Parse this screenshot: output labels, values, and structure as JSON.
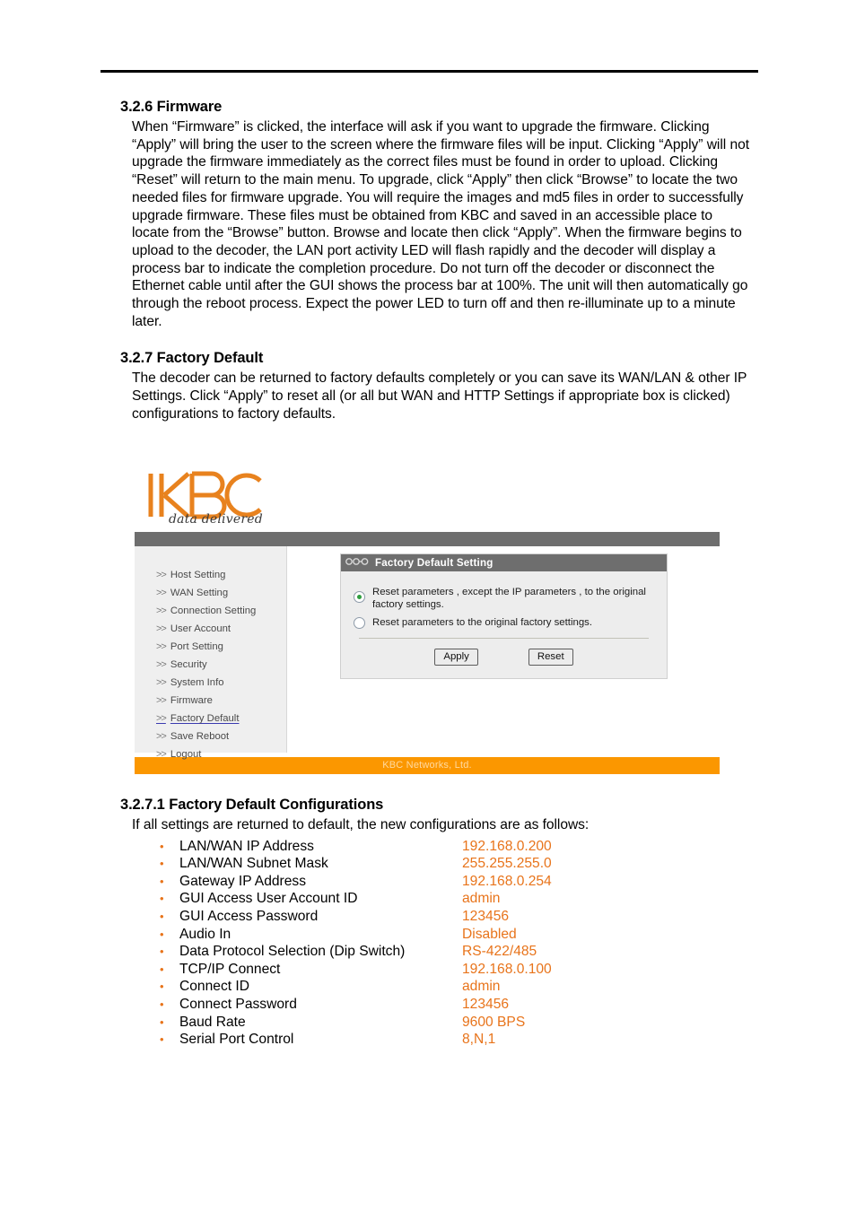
{
  "colors": {
    "accent_orange": "#e8741b",
    "ui_footer_orange": "#fb9700",
    "ui_gray_bar": "#6e6e6e",
    "ui_sidebar": "#efefef",
    "radio_selected_green": "#2f9e3f",
    "active_link_underline": "#3b3bb0"
  },
  "sections": [
    {
      "number_title": "3.2.6 Firmware",
      "body": "When “Firmware” is clicked, the interface will ask if you want to upgrade the firmware. Clicking “Apply” will bring the user to the screen where the firmware files will be input. Clicking “Apply” will not upgrade the firmware immediately as the correct files must be found in order to upload. Clicking “Reset” will return to the main menu. To upgrade, click “Apply” then click “Browse” to locate the two needed files for firmware upgrade. You will require the images and md5 files in order to successfully upgrade firmware. These files must be obtained from KBC and saved in an accessible place to locate from the “Browse” button. Browse and locate then click “Apply”. When the firmware begins to upload to the decoder, the LAN port activity LED will flash rapidly and the decoder will display a process bar to indicate the completion procedure. Do not turn off the decoder or disconnect the Ethernet cable until after the GUI shows the process bar at 100%. The unit will then automatically go through the reboot process. Expect the power LED to turn off and then re-illuminate up to a minute later."
    },
    {
      "number_title": "3.2.7 Factory Default",
      "body": "The decoder can be returned to factory defaults completely or you can save its WAN/LAN & other IP Settings. Click “Apply” to reset all (or all but WAN and HTTP Settings if appropriate box is clicked) configurations to factory defaults."
    }
  ],
  "screenshot": {
    "brand": {
      "logo_text": "KBC",
      "tagline": "data delivered"
    },
    "sidebar": {
      "arrow": ">>",
      "items": [
        {
          "label": "Host Setting",
          "active": false
        },
        {
          "label": "WAN Setting",
          "active": false
        },
        {
          "label": "Connection Setting",
          "active": false
        },
        {
          "label": "User Account",
          "active": false
        },
        {
          "label": "Port Setting",
          "active": false
        },
        {
          "label": "Security",
          "active": false
        },
        {
          "label": "System Info",
          "active": false
        },
        {
          "label": "Firmware",
          "active": false
        },
        {
          "label": "Factory Default",
          "active": true
        },
        {
          "label": "Save Reboot",
          "active": false
        },
        {
          "label": "Logout",
          "active": false
        }
      ]
    },
    "panel": {
      "title": "Factory Default Setting",
      "options": [
        {
          "label": "Reset parameters , except the IP parameters , to the original factory settings.",
          "selected": true
        },
        {
          "label": "Reset parameters to the original factory settings.",
          "selected": false
        }
      ],
      "apply_label": "Apply",
      "reset_label": "Reset"
    },
    "footer": "KBC Networks, Ltd."
  },
  "config_section": {
    "number_title": "3.2.7.1 Factory Default Configurations",
    "intro": "If all settings are returned to default, the new configurations are as follows:",
    "bullet": "•",
    "items": [
      {
        "label": "LAN/WAN IP Address",
        "value": "192.168.0.200"
      },
      {
        "label": "LAN/WAN Subnet Mask",
        "value": "255.255.255.0"
      },
      {
        "label": "Gateway IP Address",
        "value": "192.168.0.254"
      },
      {
        "label": "GUI Access User Account ID",
        "value": "admin"
      },
      {
        "label": "GUI Access Password",
        "value": "123456"
      },
      {
        "label": "Audio In",
        "value": "Disabled"
      },
      {
        "label": "Data Protocol Selection (Dip Switch)",
        "value": "RS-422/485"
      },
      {
        "label": "TCP/IP Connect",
        "value": "192.168.0.100"
      },
      {
        "label": "Connect ID",
        "value": "admin"
      },
      {
        "label": "Connect Password",
        "value": "123456"
      },
      {
        "label": "Baud Rate",
        "value": "9600 BPS"
      },
      {
        "label": "Serial Port Control",
        "value": "8,N,1"
      }
    ]
  }
}
